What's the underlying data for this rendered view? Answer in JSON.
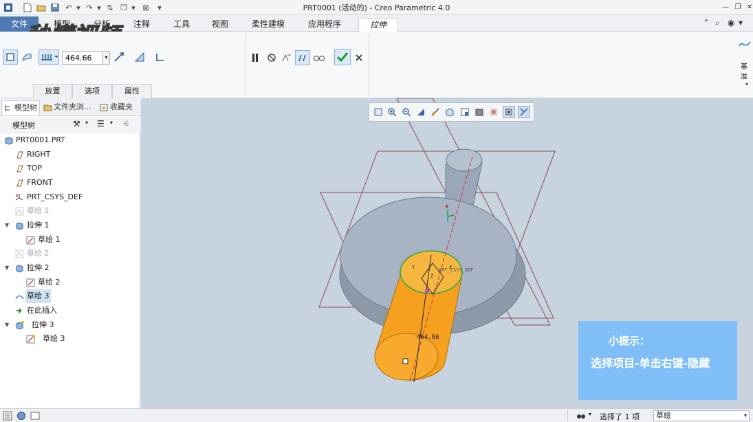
{
  "window": {
    "title": "PRT0001 (活动的) - Creo Parametric 4.0"
  },
  "tabs": {
    "file": "文件",
    "items": [
      "模型",
      "分析",
      "注释",
      "工具",
      "视图",
      "柔性建模",
      "应用程序"
    ],
    "active": "拉伸"
  },
  "ribbon": {
    "depth_value": "464.66",
    "subtabs": [
      "放置",
      "选项",
      "属性"
    ],
    "right_label": "基准"
  },
  "left_panel": {
    "tabs": [
      "模型树",
      "文件夹浏...",
      "收藏夹"
    ],
    "toolbar_title": "模型树",
    "tree": [
      {
        "label": "PRT0001.PRT",
        "icon": "part-icon"
      },
      {
        "label": "RIGHT",
        "icon": "datum-plane-icon"
      },
      {
        "label": "TOP",
        "icon": "datum-plane-icon"
      },
      {
        "label": "FRONT",
        "icon": "datum-plane-icon"
      },
      {
        "label": "PRT_CSYS_DEF",
        "icon": "csys-icon"
      },
      {
        "label": "草绘 1",
        "icon": "sketch-icon",
        "dim": true
      },
      {
        "label": "拉伸 1",
        "icon": "extrude-icon",
        "expanded": true
      },
      {
        "label": "草绘 1",
        "icon": "sketch-icon",
        "child": true
      },
      {
        "label": "草绘 2",
        "icon": "sketch-icon",
        "dim": true
      },
      {
        "label": "拉伸 2",
        "icon": "extrude-icon",
        "expanded": true
      },
      {
        "label": "草绘 2",
        "icon": "sketch-icon",
        "child": true
      },
      {
        "label": "草绘 3",
        "icon": "sketch-icon",
        "highlighted": true
      },
      {
        "label": "在此插入",
        "icon": "insert-here-icon"
      },
      {
        "label": "拉伸 3",
        "icon": "extrude-icon",
        "expanded": true,
        "new": true
      },
      {
        "label": "草绘 3",
        "icon": "sketch-icon",
        "child": true,
        "new": true
      }
    ]
  },
  "viewport": {
    "dimension_label": "464.66",
    "csys_label": "PRT_CSYS_DEF",
    "axis_labels": {
      "x": "X",
      "y": "Y",
      "z": "Z"
    }
  },
  "tip": {
    "title": "小提示：",
    "text": "选择项目-单击右键-隐藏"
  },
  "status": {
    "selected": "选择了 1 项",
    "filter": "草绘"
  },
  "watermark": {
    "text": "秒懂视频"
  },
  "colors": {
    "accent": "#4d7bb3",
    "viewport_bg": "#c7d3df",
    "extrude_orange": "#f5a01f",
    "tip_bg": "#7fbef6"
  }
}
